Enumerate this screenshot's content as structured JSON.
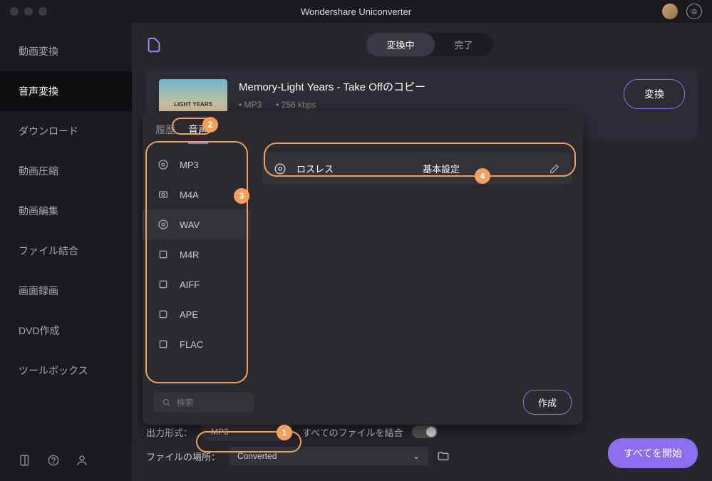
{
  "app_title": "Wondershare Uniconverter",
  "sidebar": {
    "items": [
      "動画変換",
      "音声変換",
      "ダウンロード",
      "動画圧縮",
      "動画編集",
      "ファイル結合",
      "画面録画",
      "DVD作成",
      "ツールボックス"
    ],
    "active_index": 1
  },
  "tabs": {
    "converting": "変換中",
    "done": "完了"
  },
  "file": {
    "title": "Memory-Light Years - Take Offのコピー",
    "thumb_text": "LIGHT YEARS",
    "format": "MP3",
    "bitrate": "256 kbps",
    "convert_btn": "変換"
  },
  "dropdown": {
    "tab_history": "履歴",
    "tab_audio": "音声",
    "formats": [
      "MP3",
      "M4A",
      "WAV",
      "M4R",
      "AIFF",
      "APE",
      "FLAC"
    ],
    "preset_label": "ロスレス",
    "preset_setting": "基本設定",
    "search_placeholder": "検索",
    "create_btn": "作成"
  },
  "bottom": {
    "output_format_label": "出力形式：",
    "output_format_value": "MP3",
    "merge_label": "すべてのファイルを結合",
    "location_label": "ファイルの場所：",
    "location_value": "Converted",
    "start_all": "すべてを開始"
  },
  "annotations": {
    "n1": "1",
    "n2": "2",
    "n3": "3",
    "n4": "4"
  }
}
